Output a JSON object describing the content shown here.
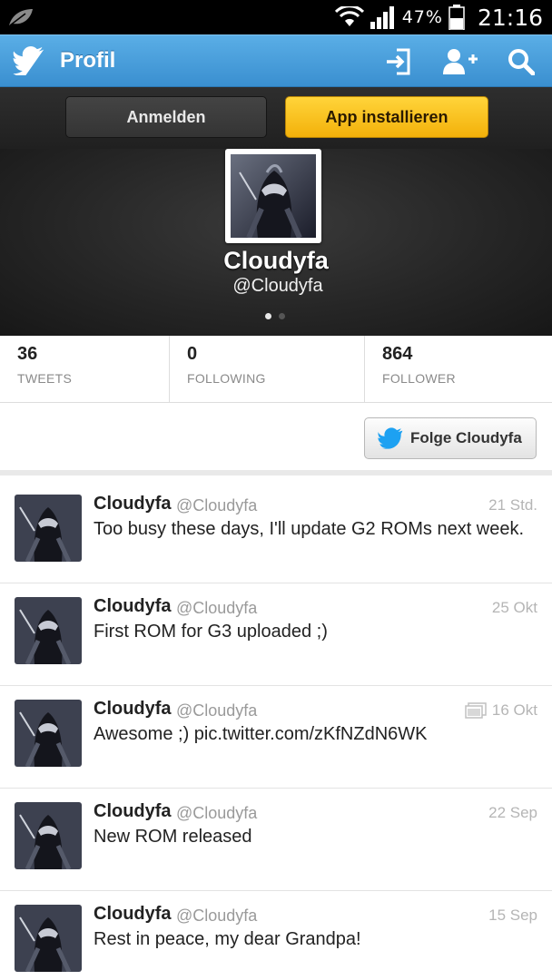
{
  "statusbar": {
    "battery_pct": "47%",
    "time": "21:16"
  },
  "appbar": {
    "title": "Profil"
  },
  "loginbar": {
    "login_label": "Anmelden",
    "install_label": "App installieren"
  },
  "profile": {
    "name": "Cloudyfa",
    "handle": "@Cloudyfa",
    "page_count": 2,
    "active_page": 1
  },
  "stats": [
    {
      "value": "36",
      "label": "TWEETS"
    },
    {
      "value": "0",
      "label": "FOLLOWING"
    },
    {
      "value": "864",
      "label": "FOLLOWER"
    }
  ],
  "follow": {
    "label": "Folge Cloudyfa"
  },
  "tweets": [
    {
      "name": "Cloudyfa",
      "handle": "@Cloudyfa",
      "time": "21 Std.",
      "text": "Too busy these days, I'll update G2 ROMs next week.",
      "has_media": false
    },
    {
      "name": "Cloudyfa",
      "handle": "@Cloudyfa",
      "time": "25 Okt",
      "text": "First ROM for G3 uploaded ;)",
      "has_media": false
    },
    {
      "name": "Cloudyfa",
      "handle": "@Cloudyfa",
      "time": "16 Okt",
      "text": "Awesome ;) pic.twitter.com/zKfNZdN6WK",
      "has_media": true
    },
    {
      "name": "Cloudyfa",
      "handle": "@Cloudyfa",
      "time": "22 Sep",
      "text": "New ROM released",
      "has_media": false
    },
    {
      "name": "Cloudyfa",
      "handle": "@Cloudyfa",
      "time": "15 Sep",
      "text": "Rest in peace, my dear Grandpa!",
      "has_media": false
    }
  ],
  "icons": {
    "statusbar": [
      "leaf-icon",
      "wifi-icon",
      "signal-icon",
      "battery-icon"
    ],
    "appbar": [
      "twitter-bird-icon",
      "sign-in-icon",
      "add-user-icon",
      "search-icon"
    ]
  },
  "colors": {
    "appbar": "#3a8fd0",
    "install_button": "#f3b10a",
    "twitter_blue": "#1da1f2"
  }
}
